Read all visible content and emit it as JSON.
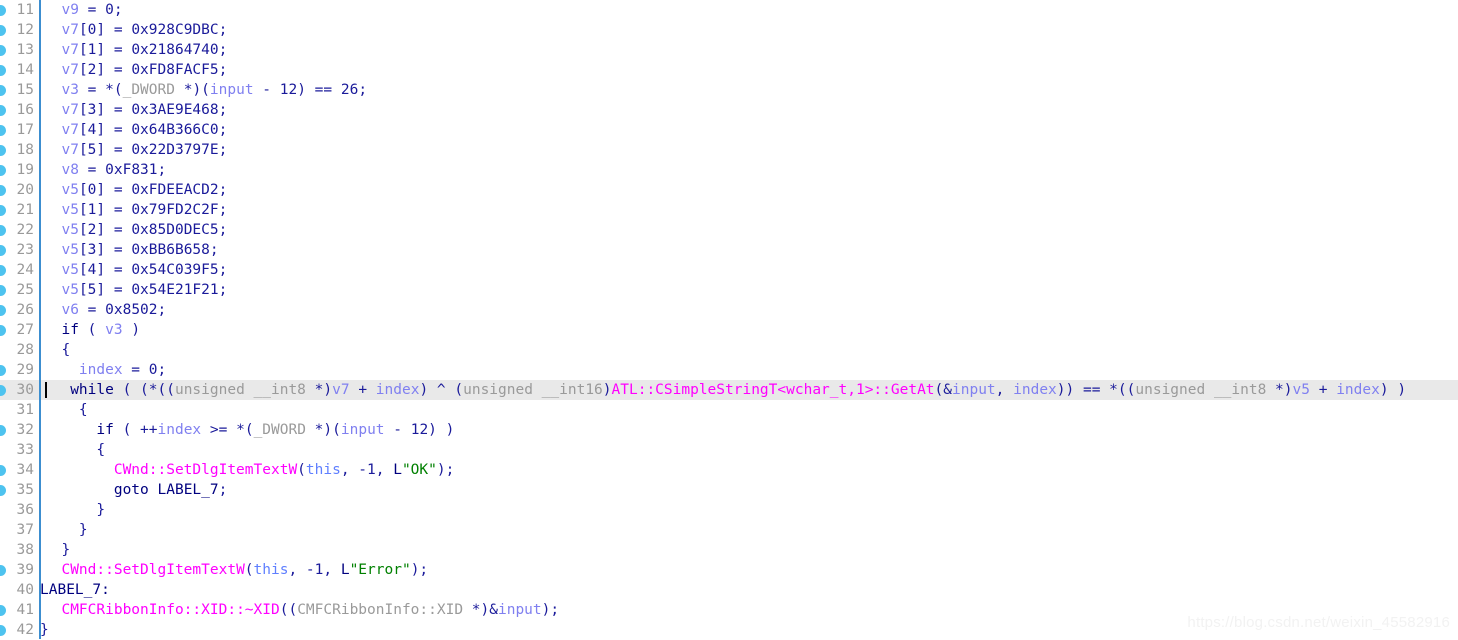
{
  "editor": {
    "kind": "decompiler-pseudocode-listing",
    "language": "c",
    "current_line": 30,
    "gutter_rule_color": "#3c8ed0",
    "current_line_highlight": "#e9e9e9",
    "breakpoint_dot_color": "#4ec3ef",
    "colors": {
      "background": "#ffffff",
      "line_number": "#9a9a9a",
      "default_text": "#1a1a9a",
      "keyword": "#00007f",
      "variable": "#8080f0",
      "type": "#9a9a9a",
      "function": "#ff00ff",
      "string": "#008000",
      "this_pointer": "#5f7fff",
      "watermark": "#f2f2f2"
    }
  },
  "watermark": {
    "text": "https://blog.csdn.net/weixin_45582916"
  },
  "lines": [
    {
      "number": "11",
      "dot": true,
      "tokens": [
        {
          "t": "  ",
          "c": "plain"
        },
        {
          "t": "v9",
          "c": "var"
        },
        {
          "t": " = 0;",
          "c": "plain"
        }
      ]
    },
    {
      "number": "12",
      "dot": true,
      "tokens": [
        {
          "t": "  ",
          "c": "plain"
        },
        {
          "t": "v7",
          "c": "var"
        },
        {
          "t": "[0] = 0x928C9DBC;",
          "c": "plain"
        }
      ]
    },
    {
      "number": "13",
      "dot": true,
      "tokens": [
        {
          "t": "  ",
          "c": "plain"
        },
        {
          "t": "v7",
          "c": "var"
        },
        {
          "t": "[1] = 0x21864740;",
          "c": "plain"
        }
      ]
    },
    {
      "number": "14",
      "dot": true,
      "tokens": [
        {
          "t": "  ",
          "c": "plain"
        },
        {
          "t": "v7",
          "c": "var"
        },
        {
          "t": "[2] = 0xFD8FACF5;",
          "c": "plain"
        }
      ]
    },
    {
      "number": "15",
      "dot": true,
      "tokens": [
        {
          "t": "  ",
          "c": "plain"
        },
        {
          "t": "v3",
          "c": "var"
        },
        {
          "t": " = *(",
          "c": "plain"
        },
        {
          "t": "_DWORD",
          "c": "type"
        },
        {
          "t": " *)(",
          "c": "plain"
        },
        {
          "t": "input",
          "c": "var"
        },
        {
          "t": " - 12) == 26;",
          "c": "plain"
        }
      ]
    },
    {
      "number": "16",
      "dot": true,
      "tokens": [
        {
          "t": "  ",
          "c": "plain"
        },
        {
          "t": "v7",
          "c": "var"
        },
        {
          "t": "[3] = 0x3AE9E468;",
          "c": "plain"
        }
      ]
    },
    {
      "number": "17",
      "dot": true,
      "tokens": [
        {
          "t": "  ",
          "c": "plain"
        },
        {
          "t": "v7",
          "c": "var"
        },
        {
          "t": "[4] = 0x64B366C0;",
          "c": "plain"
        }
      ]
    },
    {
      "number": "18",
      "dot": true,
      "tokens": [
        {
          "t": "  ",
          "c": "plain"
        },
        {
          "t": "v7",
          "c": "var"
        },
        {
          "t": "[5] = 0x22D3797E;",
          "c": "plain"
        }
      ]
    },
    {
      "number": "19",
      "dot": true,
      "tokens": [
        {
          "t": "  ",
          "c": "plain"
        },
        {
          "t": "v8",
          "c": "var"
        },
        {
          "t": " = 0xF831;",
          "c": "plain"
        }
      ]
    },
    {
      "number": "20",
      "dot": true,
      "tokens": [
        {
          "t": "  ",
          "c": "plain"
        },
        {
          "t": "v5",
          "c": "var"
        },
        {
          "t": "[0] = 0xFDEEACD2;",
          "c": "plain"
        }
      ]
    },
    {
      "number": "21",
      "dot": true,
      "tokens": [
        {
          "t": "  ",
          "c": "plain"
        },
        {
          "t": "v5",
          "c": "var"
        },
        {
          "t": "[1] = 0x79FD2C2F;",
          "c": "plain"
        }
      ]
    },
    {
      "number": "22",
      "dot": true,
      "tokens": [
        {
          "t": "  ",
          "c": "plain"
        },
        {
          "t": "v5",
          "c": "var"
        },
        {
          "t": "[2] = 0x85D0DEC5;",
          "c": "plain"
        }
      ]
    },
    {
      "number": "23",
      "dot": true,
      "tokens": [
        {
          "t": "  ",
          "c": "plain"
        },
        {
          "t": "v5",
          "c": "var"
        },
        {
          "t": "[3] = 0xBB6B658;",
          "c": "plain"
        }
      ]
    },
    {
      "number": "24",
      "dot": true,
      "tokens": [
        {
          "t": "  ",
          "c": "plain"
        },
        {
          "t": "v5",
          "c": "var"
        },
        {
          "t": "[4] = 0x54C039F5;",
          "c": "plain"
        }
      ]
    },
    {
      "number": "25",
      "dot": true,
      "tokens": [
        {
          "t": "  ",
          "c": "plain"
        },
        {
          "t": "v5",
          "c": "var"
        },
        {
          "t": "[5] = 0x54E21F21;",
          "c": "plain"
        }
      ]
    },
    {
      "number": "26",
      "dot": true,
      "tokens": [
        {
          "t": "  ",
          "c": "plain"
        },
        {
          "t": "v6",
          "c": "var"
        },
        {
          "t": " = 0x8502;",
          "c": "plain"
        }
      ]
    },
    {
      "number": "27",
      "dot": true,
      "tokens": [
        {
          "t": "  ",
          "c": "plain"
        },
        {
          "t": "if",
          "c": "kw"
        },
        {
          "t": " ( ",
          "c": "plain"
        },
        {
          "t": "v3",
          "c": "var"
        },
        {
          "t": " )",
          "c": "plain"
        }
      ]
    },
    {
      "number": "28",
      "dot": false,
      "tokens": [
        {
          "t": "  {",
          "c": "plain"
        }
      ]
    },
    {
      "number": "29",
      "dot": true,
      "tokens": [
        {
          "t": "    ",
          "c": "plain"
        },
        {
          "t": "index",
          "c": "var"
        },
        {
          "t": " = 0;",
          "c": "plain"
        }
      ]
    },
    {
      "number": "30",
      "dot": true,
      "current": true,
      "tokens": [
        {
          "t": "   ",
          "c": "plain"
        },
        {
          "t": "while",
          "c": "kw"
        },
        {
          "t": " ( (*((",
          "c": "plain"
        },
        {
          "t": "unsigned __int8",
          "c": "type"
        },
        {
          "t": " *)",
          "c": "plain"
        },
        {
          "t": "v7",
          "c": "var"
        },
        {
          "t": " + ",
          "c": "plain"
        },
        {
          "t": "index",
          "c": "var"
        },
        {
          "t": ") ^ (",
          "c": "plain"
        },
        {
          "t": "unsigned __int16",
          "c": "type"
        },
        {
          "t": ")",
          "c": "plain"
        },
        {
          "t": "ATL::CSimpleStringT<wchar_t,1>::GetAt",
          "c": "func"
        },
        {
          "t": "(&",
          "c": "plain"
        },
        {
          "t": "input",
          "c": "var"
        },
        {
          "t": ", ",
          "c": "plain"
        },
        {
          "t": "index",
          "c": "var"
        },
        {
          "t": ")) == *((",
          "c": "plain"
        },
        {
          "t": "unsigned __int8",
          "c": "type"
        },
        {
          "t": " *)",
          "c": "plain"
        },
        {
          "t": "v5",
          "c": "var"
        },
        {
          "t": " + ",
          "c": "plain"
        },
        {
          "t": "index",
          "c": "var"
        },
        {
          "t": ") )",
          "c": "plain"
        }
      ]
    },
    {
      "number": "31",
      "dot": false,
      "tokens": [
        {
          "t": "    {",
          "c": "plain"
        }
      ]
    },
    {
      "number": "32",
      "dot": true,
      "tokens": [
        {
          "t": "      ",
          "c": "plain"
        },
        {
          "t": "if",
          "c": "kw"
        },
        {
          "t": " ( ++",
          "c": "plain"
        },
        {
          "t": "index",
          "c": "var"
        },
        {
          "t": " >= *(",
          "c": "plain"
        },
        {
          "t": "_DWORD",
          "c": "type"
        },
        {
          "t": " *)(",
          "c": "plain"
        },
        {
          "t": "input",
          "c": "var"
        },
        {
          "t": " - 12) )",
          "c": "plain"
        }
      ]
    },
    {
      "number": "33",
      "dot": false,
      "tokens": [
        {
          "t": "      {",
          "c": "plain"
        }
      ]
    },
    {
      "number": "34",
      "dot": true,
      "tokens": [
        {
          "t": "        ",
          "c": "plain"
        },
        {
          "t": "CWnd::SetDlgItemTextW",
          "c": "func"
        },
        {
          "t": "(",
          "c": "plain"
        },
        {
          "t": "this",
          "c": "this"
        },
        {
          "t": ", -1, ",
          "c": "plain"
        },
        {
          "t": "L",
          "c": "kw"
        },
        {
          "t": "\"OK\"",
          "c": "str"
        },
        {
          "t": ");",
          "c": "plain"
        }
      ]
    },
    {
      "number": "35",
      "dot": true,
      "tokens": [
        {
          "t": "        ",
          "c": "plain"
        },
        {
          "t": "goto",
          "c": "kw"
        },
        {
          "t": " ",
          "c": "plain"
        },
        {
          "t": "LABEL_7",
          "c": "label"
        },
        {
          "t": ";",
          "c": "plain"
        }
      ]
    },
    {
      "number": "36",
      "dot": false,
      "tokens": [
        {
          "t": "      }",
          "c": "plain"
        }
      ]
    },
    {
      "number": "37",
      "dot": false,
      "tokens": [
        {
          "t": "    }",
          "c": "plain"
        }
      ]
    },
    {
      "number": "38",
      "dot": false,
      "tokens": [
        {
          "t": "  }",
          "c": "plain"
        }
      ]
    },
    {
      "number": "39",
      "dot": true,
      "tokens": [
        {
          "t": "  ",
          "c": "plain"
        },
        {
          "t": "CWnd::SetDlgItemTextW",
          "c": "func"
        },
        {
          "t": "(",
          "c": "plain"
        },
        {
          "t": "this",
          "c": "this"
        },
        {
          "t": ", -1, ",
          "c": "plain"
        },
        {
          "t": "L",
          "c": "kw"
        },
        {
          "t": "\"Error\"",
          "c": "str"
        },
        {
          "t": ");",
          "c": "plain"
        }
      ]
    },
    {
      "number": "40",
      "dot": false,
      "nogutterpad": true,
      "tokens": [
        {
          "t": "LABEL_7:",
          "c": "label"
        }
      ]
    },
    {
      "number": "41",
      "dot": true,
      "tokens": [
        {
          "t": "  ",
          "c": "plain"
        },
        {
          "t": "CMFCRibbonInfo::XID::~XID",
          "c": "func"
        },
        {
          "t": "((",
          "c": "plain"
        },
        {
          "t": "CMFCRibbonInfo::XID",
          "c": "type"
        },
        {
          "t": " *)&",
          "c": "plain"
        },
        {
          "t": "input",
          "c": "var"
        },
        {
          "t": ");",
          "c": "plain"
        }
      ]
    },
    {
      "number": "42",
      "dot": true,
      "nogutterpad": true,
      "tokens": [
        {
          "t": "}",
          "c": "plain"
        }
      ]
    }
  ]
}
